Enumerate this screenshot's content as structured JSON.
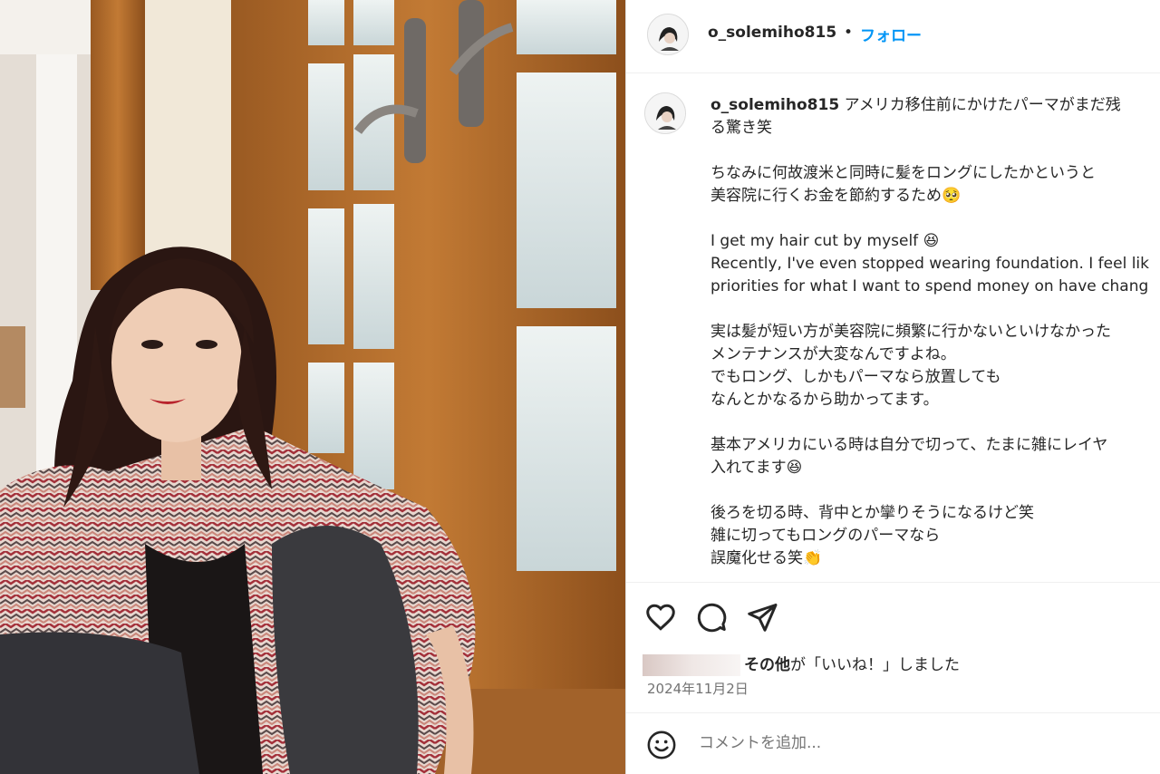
{
  "post": {
    "username": "o_solemiho815",
    "separator": "•",
    "follow_label": "フォロー",
    "caption_first_text": "アメリカ移住前にかけたパーマがまだ残",
    "caption_first_cont": "る驚き笑",
    "caption_lines": [
      "ちなみに何故渡米と同時に髪をロングにしたかというと",
      "美容院に行くお金を節約するため🥺",
      "",
      "I get my hair cut by myself 😆",
      "Recently, I've even stopped wearing foundation. I feel lik",
      "priorities for what I want to spend money on have chang",
      "",
      "実は髪が短い方が美容院に頻繁に行かないといけなかった",
      "メンテナンスが大変なんですよね。",
      "でもロング、しかもパーマなら放置しても",
      "なんとかなるから助かってます。",
      "",
      "基本アメリカにいる時は自分で切って、たまに雑にレイヤ",
      "入れてます😆",
      "",
      "後ろを切る時、背中とか攣りそうになるけど笑",
      "雑に切ってもロングのパーマなら",
      "誤魔化せる笑👏"
    ],
    "likes_bold": "その他",
    "likes_rest": "が「いいね！」しました",
    "date": "2024年11月2日",
    "comment_placeholder": "コメントを追加..."
  },
  "icons": {
    "like": "heart-icon",
    "comment": "comment-icon",
    "share": "share-icon",
    "emoji": "emoji-icon"
  }
}
